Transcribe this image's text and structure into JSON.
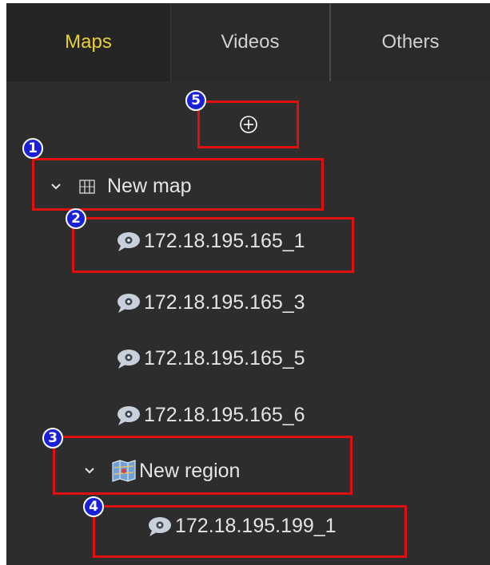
{
  "tabs": [
    {
      "label": "Maps",
      "active": true
    },
    {
      "label": "Videos",
      "active": false
    },
    {
      "label": "Others",
      "active": false
    }
  ],
  "tree": {
    "add_icon": "plus-circle-icon",
    "map": {
      "label": "New map",
      "icon": "map-icon",
      "expanded": true
    },
    "map_devices": [
      {
        "label": "172.18.195.165_1",
        "icon": "camera-bubble-icon"
      },
      {
        "label": "172.18.195.165_3",
        "icon": "camera-bubble-icon"
      },
      {
        "label": "172.18.195.165_5",
        "icon": "camera-bubble-icon"
      },
      {
        "label": "172.18.195.165_6",
        "icon": "camera-bubble-icon"
      }
    ],
    "region": {
      "label": "New region",
      "icon": "region-map-icon",
      "expanded": true
    },
    "region_devices": [
      {
        "label": "172.18.195.199_1",
        "icon": "camera-bubble-icon"
      }
    ]
  },
  "callouts": [
    "1",
    "2",
    "3",
    "4",
    "5"
  ],
  "colors": {
    "active_tab": "#e8d03a",
    "highlight": "#e01010",
    "badge": "#1a1fd8",
    "panel": "#2d2d2d"
  }
}
